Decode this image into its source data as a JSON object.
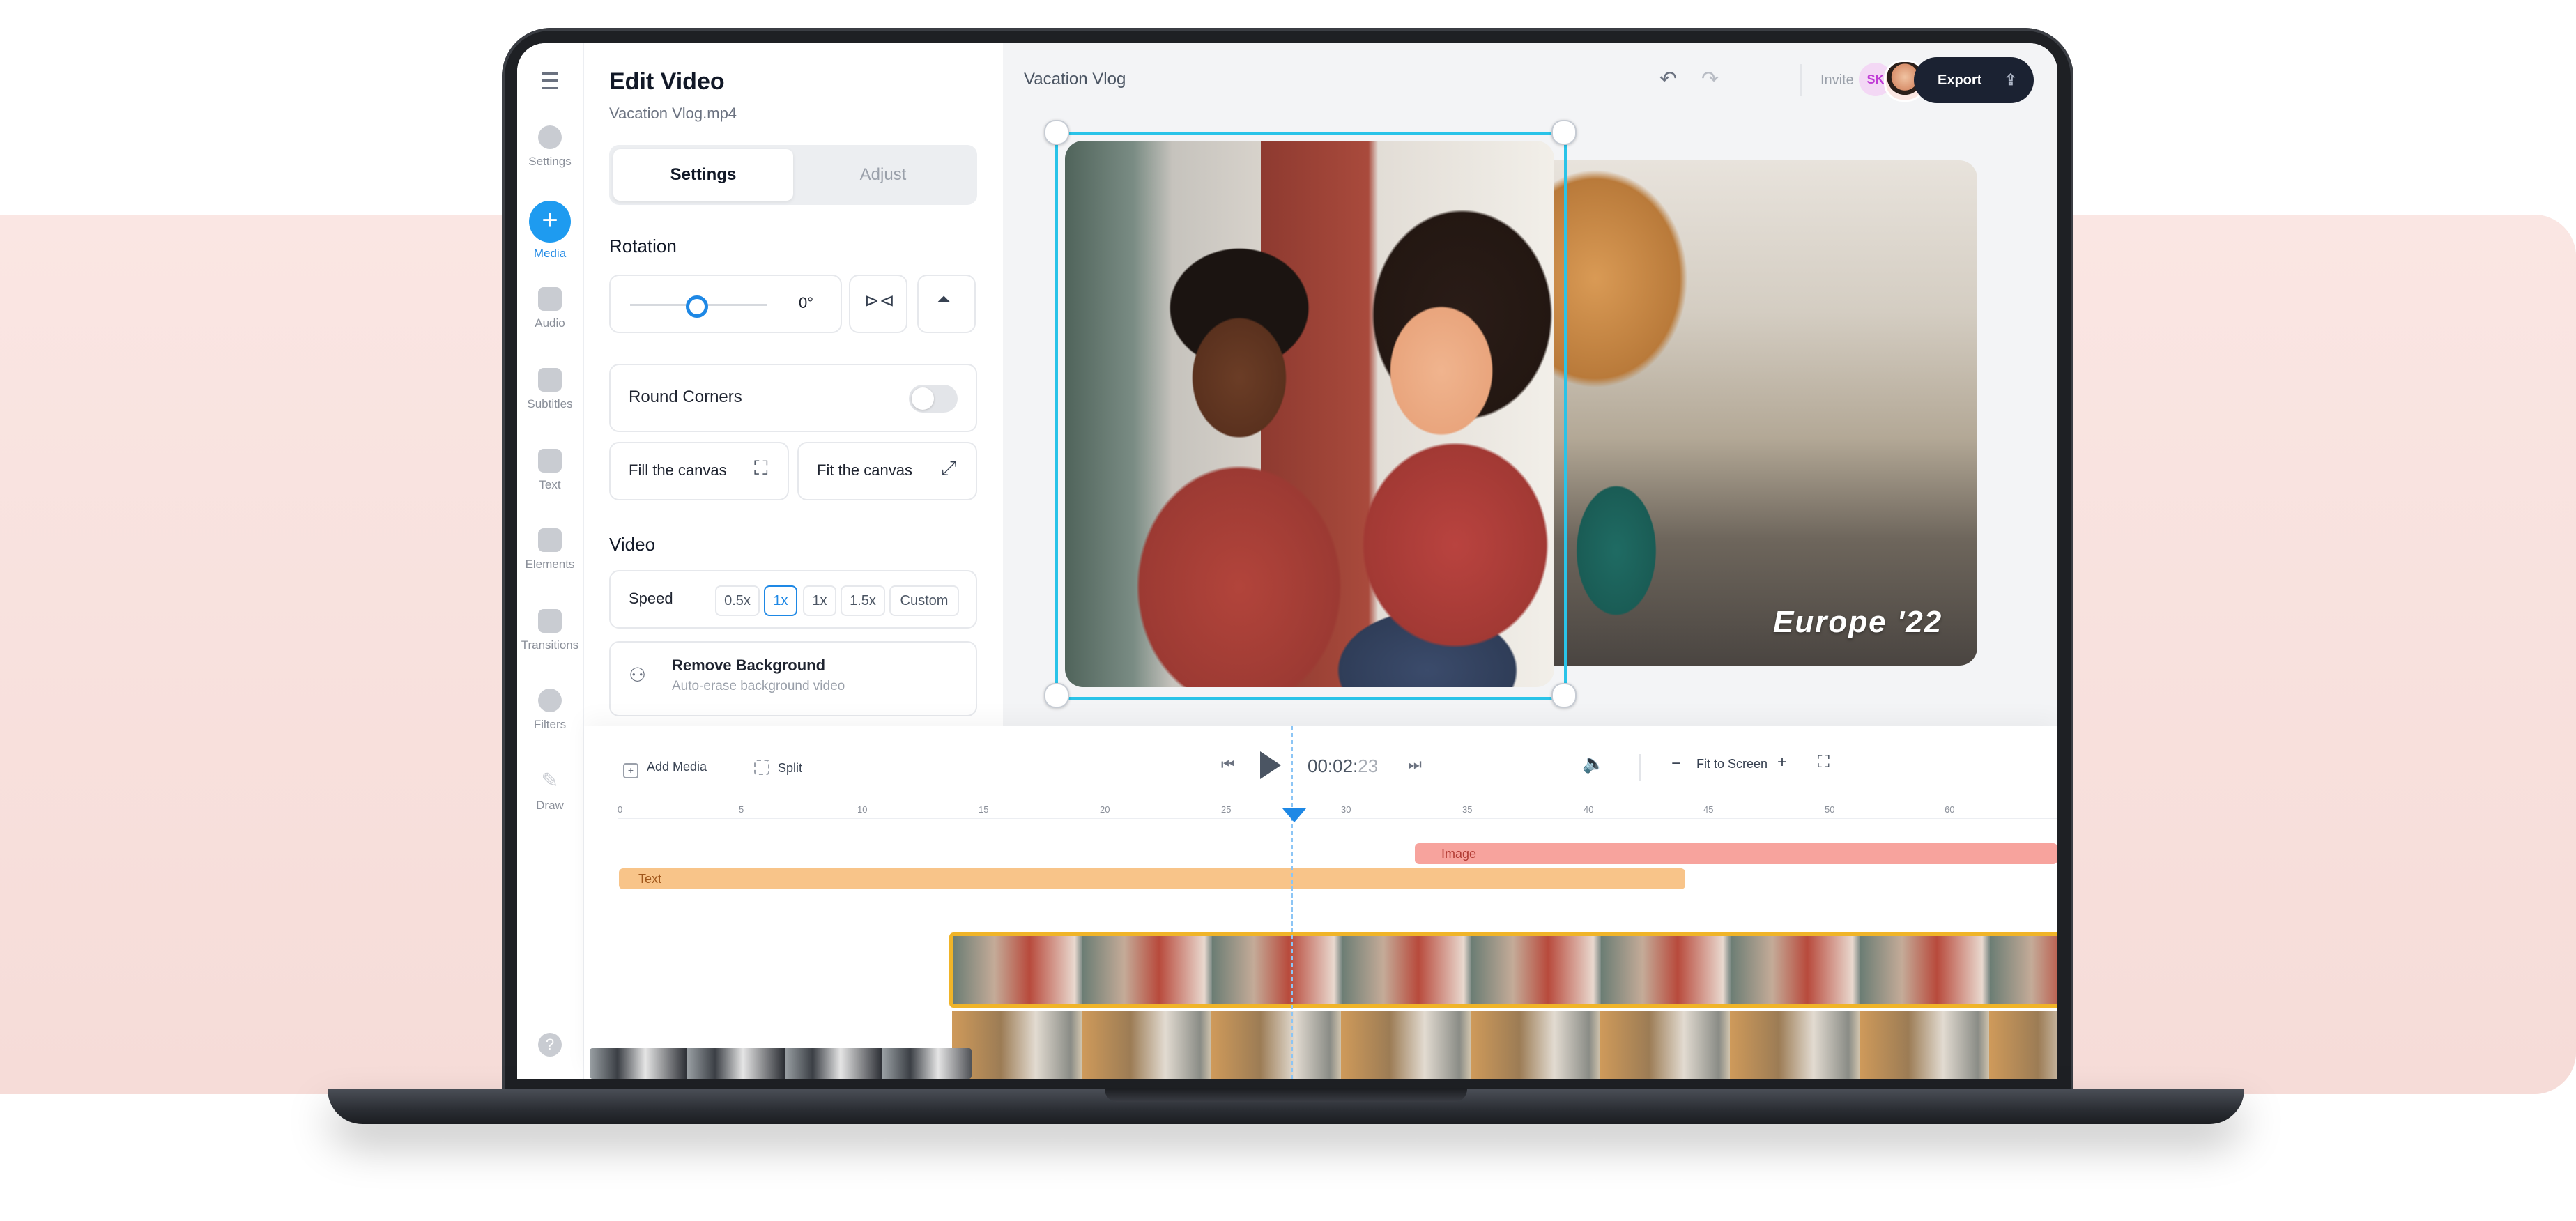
{
  "sidebar": {
    "items": [
      {
        "label": "Settings",
        "icon": "gear-icon"
      },
      {
        "label": "Media",
        "icon": "plus-icon"
      },
      {
        "label": "Audio",
        "icon": "music-note-icon"
      },
      {
        "label": "Subtitles",
        "icon": "subtitles-icon"
      },
      {
        "label": "Text",
        "icon": "text-icon"
      },
      {
        "label": "Elements",
        "icon": "sticker-icon"
      },
      {
        "label": "Transitions",
        "icon": "transition-icon"
      },
      {
        "label": "Filters",
        "icon": "filter-icon"
      },
      {
        "label": "Draw",
        "icon": "pen-icon"
      }
    ],
    "help": "?"
  },
  "panel": {
    "title": "Edit Video",
    "file": "Vacation Vlog.mp4",
    "tabs": [
      "Settings",
      "Adjust"
    ],
    "rotation": {
      "title": "Rotation",
      "value": "0°"
    },
    "round_corners": "Round Corners",
    "fill_canvas": "Fill the canvas",
    "fit_canvas": "Fit the canvas",
    "video_title": "Video",
    "speed": {
      "label": "Speed",
      "options": [
        "0.5x",
        "1x",
        "1x",
        "1.5x",
        "Custom"
      ],
      "selected_index": 1
    },
    "remove_bg": {
      "title": "Remove Background",
      "subtitle": "Auto-erase background video"
    }
  },
  "preview": {
    "title": "Vacation Vlog",
    "invite": "Invite",
    "avatar_initials": "SK",
    "export": "Export",
    "overlay_text": "Europe '22"
  },
  "timeline": {
    "add_media": "Add Media",
    "split": "Split",
    "time_main": "00:02:",
    "time_frames": "23",
    "fit_to_screen": "Fit to Screen",
    "ruler": [
      "0",
      "5",
      "10",
      "15",
      "20",
      "25",
      "30",
      "35",
      "40",
      "45",
      "50",
      "60"
    ],
    "clip_image": "Image",
    "clip_text": "Text"
  },
  "colors": {
    "accent": "#1e88e5",
    "selection": "#29c3e8",
    "export_bg": "#1b2232",
    "clip_image": "#f7a39d",
    "clip_text": "#f8c489",
    "film_border": "#f0b428"
  }
}
